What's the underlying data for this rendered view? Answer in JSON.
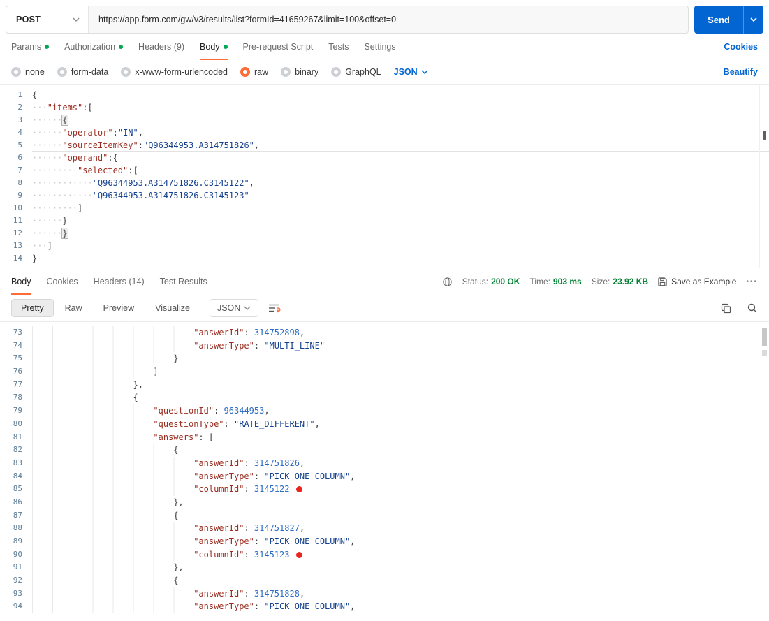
{
  "colors": {
    "accent_orange": "#ff6c37",
    "link_blue": "#0265d2",
    "success_green": "#007f31",
    "dot_green": "#00a854",
    "send_blue": "#0265d2",
    "marker_red": "#e8251f"
  },
  "icons": {
    "more_options": "•••"
  },
  "request_bar": {
    "method": "POST",
    "url": "https://app.form.com/gw/v3/results/list?formId=41659267&limit=100&offset=0",
    "send_label": "Send"
  },
  "request_tabs": {
    "items": [
      {
        "label": "Params",
        "dot": true,
        "active": false
      },
      {
        "label": "Authorization",
        "dot": true,
        "active": false
      },
      {
        "label": "Headers (9)",
        "dot": false,
        "active": false
      },
      {
        "label": "Body",
        "dot": true,
        "active": true
      },
      {
        "label": "Pre-request Script",
        "dot": false,
        "active": false
      },
      {
        "label": "Tests",
        "dot": false,
        "active": false
      },
      {
        "label": "Settings",
        "dot": false,
        "active": false
      }
    ],
    "cookies_link": "Cookies"
  },
  "body_type_bar": {
    "options": [
      {
        "label": "none",
        "selected": false
      },
      {
        "label": "form-data",
        "selected": false
      },
      {
        "label": "x-www-form-urlencoded",
        "selected": false
      },
      {
        "label": "raw",
        "selected": true
      },
      {
        "label": "binary",
        "selected": false
      },
      {
        "label": "GraphQL",
        "selected": false
      }
    ],
    "language": "JSON",
    "beautify_link": "Beautify"
  },
  "request_editor": {
    "lines": [
      {
        "n": 1,
        "dots": 0,
        "tokens": [
          [
            "p",
            "{"
          ]
        ]
      },
      {
        "n": 2,
        "dots": 3,
        "tokens": [
          [
            "k",
            "\"items\""
          ],
          [
            "p",
            ":["
          ]
        ]
      },
      {
        "n": 3,
        "dots": 6,
        "rule": true,
        "tokens": [
          [
            "pb",
            "{"
          ]
        ]
      },
      {
        "n": 4,
        "dots": 6,
        "tokens": [
          [
            "k",
            "\"operator\""
          ],
          [
            "p",
            ":"
          ],
          [
            "s",
            "\"IN\""
          ],
          [
            "p",
            ","
          ]
        ]
      },
      {
        "n": 5,
        "dots": 6,
        "rule": true,
        "tokens": [
          [
            "k",
            "\"sourceItemKey\""
          ],
          [
            "p",
            ":"
          ],
          [
            "s",
            "\"Q96344953.A314751826\""
          ],
          [
            "p",
            ","
          ]
        ]
      },
      {
        "n": 6,
        "dots": 6,
        "tokens": [
          [
            "k",
            "\"operand\""
          ],
          [
            "p",
            ":{"
          ]
        ]
      },
      {
        "n": 7,
        "dots": 9,
        "tokens": [
          [
            "k",
            "\"selected\""
          ],
          [
            "p",
            ":["
          ]
        ]
      },
      {
        "n": 8,
        "dots": 12,
        "tokens": [
          [
            "s",
            "\"Q96344953.A314751826.C3145122\""
          ],
          [
            "p",
            ","
          ]
        ]
      },
      {
        "n": 9,
        "dots": 12,
        "tokens": [
          [
            "s",
            "\"Q96344953.A314751826.C3145123\""
          ]
        ]
      },
      {
        "n": 10,
        "dots": 9,
        "tokens": [
          [
            "p",
            "]"
          ]
        ]
      },
      {
        "n": 11,
        "dots": 6,
        "tokens": [
          [
            "p",
            "}"
          ]
        ]
      },
      {
        "n": 12,
        "dots": 6,
        "tokens": [
          [
            "pb",
            "}"
          ]
        ]
      },
      {
        "n": 13,
        "dots": 3,
        "tokens": [
          [
            "p",
            "]"
          ]
        ]
      },
      {
        "n": 14,
        "dots": 0,
        "tokens": [
          [
            "p",
            "}"
          ]
        ]
      }
    ]
  },
  "response_meta": {
    "tabs": [
      {
        "label": "Body",
        "active": true
      },
      {
        "label": "Cookies",
        "active": false
      },
      {
        "label": "Headers (14)",
        "active": false
      },
      {
        "label": "Test Results",
        "active": false
      }
    ],
    "status_label": "Status:",
    "status_value": "200 OK",
    "time_label": "Time:",
    "time_value": "903 ms",
    "size_label": "Size:",
    "size_value": "23.92 KB",
    "save_as_example_label": "Save as Example",
    "more_options_glyph": "•••"
  },
  "response_toolbar": {
    "views": [
      {
        "label": "Pretty",
        "active": true
      },
      {
        "label": "Raw",
        "active": false
      },
      {
        "label": "Preview",
        "active": false
      },
      {
        "label": "Visualize",
        "active": false
      }
    ],
    "language": "JSON"
  },
  "response_editor": {
    "lines": [
      {
        "n": 73,
        "level": 8,
        "tokens": [
          [
            "k",
            "\"answerId\""
          ],
          [
            "p",
            ": "
          ],
          [
            "num",
            "314752898"
          ],
          [
            "p",
            ","
          ]
        ]
      },
      {
        "n": 74,
        "level": 8,
        "tokens": [
          [
            "k",
            "\"answerType\""
          ],
          [
            "p",
            ": "
          ],
          [
            "s",
            "\"MULTI_LINE\""
          ]
        ]
      },
      {
        "n": 75,
        "level": 7,
        "tokens": [
          [
            "p",
            "}"
          ]
        ]
      },
      {
        "n": 76,
        "level": 6,
        "tokens": [
          [
            "p",
            "]"
          ]
        ]
      },
      {
        "n": 77,
        "level": 5,
        "tokens": [
          [
            "p",
            "},"
          ]
        ]
      },
      {
        "n": 78,
        "level": 5,
        "tokens": [
          [
            "p",
            "{"
          ]
        ]
      },
      {
        "n": 79,
        "level": 6,
        "tokens": [
          [
            "k",
            "\"questionId\""
          ],
          [
            "p",
            ": "
          ],
          [
            "num",
            "96344953"
          ],
          [
            "p",
            ","
          ]
        ]
      },
      {
        "n": 80,
        "level": 6,
        "tokens": [
          [
            "k",
            "\"questionType\""
          ],
          [
            "p",
            ": "
          ],
          [
            "s",
            "\"RATE_DIFFERENT\""
          ],
          [
            "p",
            ","
          ]
        ]
      },
      {
        "n": 81,
        "level": 6,
        "tokens": [
          [
            "k",
            "\"answers\""
          ],
          [
            "p",
            ": ["
          ]
        ]
      },
      {
        "n": 82,
        "level": 7,
        "tokens": [
          [
            "p",
            "{"
          ]
        ]
      },
      {
        "n": 83,
        "level": 8,
        "tokens": [
          [
            "k",
            "\"answerId\""
          ],
          [
            "p",
            ": "
          ],
          [
            "num",
            "314751826"
          ],
          [
            "p",
            ","
          ]
        ]
      },
      {
        "n": 84,
        "level": 8,
        "tokens": [
          [
            "k",
            "\"answerType\""
          ],
          [
            "p",
            ": "
          ],
          [
            "s",
            "\"PICK_ONE_COLUMN\""
          ],
          [
            "p",
            ","
          ]
        ]
      },
      {
        "n": 85,
        "level": 8,
        "marker": true,
        "tokens": [
          [
            "k",
            "\"columnId\""
          ],
          [
            "p",
            ": "
          ],
          [
            "num",
            "3145122"
          ]
        ]
      },
      {
        "n": 86,
        "level": 7,
        "tokens": [
          [
            "p",
            "},"
          ]
        ]
      },
      {
        "n": 87,
        "level": 7,
        "tokens": [
          [
            "p",
            "{"
          ]
        ]
      },
      {
        "n": 88,
        "level": 8,
        "tokens": [
          [
            "k",
            "\"answerId\""
          ],
          [
            "p",
            ": "
          ],
          [
            "num",
            "314751827"
          ],
          [
            "p",
            ","
          ]
        ]
      },
      {
        "n": 89,
        "level": 8,
        "tokens": [
          [
            "k",
            "\"answerType\""
          ],
          [
            "p",
            ": "
          ],
          [
            "s",
            "\"PICK_ONE_COLUMN\""
          ],
          [
            "p",
            ","
          ]
        ]
      },
      {
        "n": 90,
        "level": 8,
        "marker": true,
        "tokens": [
          [
            "k",
            "\"columnId\""
          ],
          [
            "p",
            ": "
          ],
          [
            "num",
            "3145123"
          ]
        ]
      },
      {
        "n": 91,
        "level": 7,
        "tokens": [
          [
            "p",
            "},"
          ]
        ]
      },
      {
        "n": 92,
        "level": 7,
        "tokens": [
          [
            "p",
            "{"
          ]
        ]
      },
      {
        "n": 93,
        "level": 8,
        "tokens": [
          [
            "k",
            "\"answerId\""
          ],
          [
            "p",
            ": "
          ],
          [
            "num",
            "314751828"
          ],
          [
            "p",
            ","
          ]
        ]
      },
      {
        "n": 94,
        "level": 8,
        "tokens": [
          [
            "k",
            "\"answerType\""
          ],
          [
            "p",
            ": "
          ],
          [
            "s",
            "\"PICK_ONE_COLUMN\""
          ],
          [
            "p",
            ","
          ]
        ]
      }
    ]
  }
}
